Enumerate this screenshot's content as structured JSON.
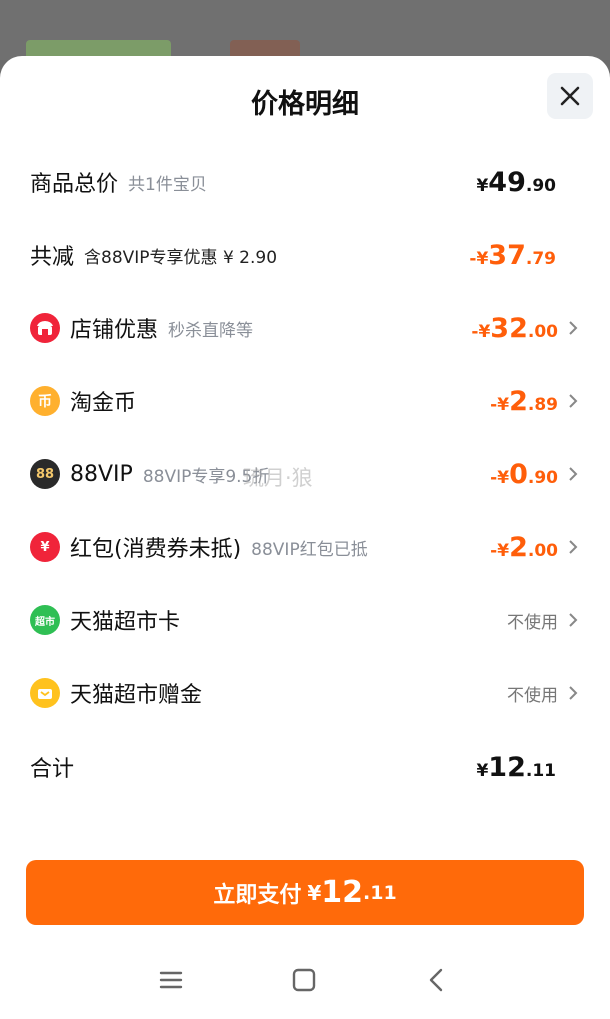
{
  "title": "价格明细",
  "rows": [
    {
      "label": "商品总价",
      "sub": "共1件宝贝",
      "sign": "",
      "currency": "¥",
      "int": "49",
      "dec": ".90"
    },
    {
      "label": "共减",
      "sub": "含88VIP专享优惠 ¥ 2.90",
      "sign": "-",
      "currency": "¥",
      "int": "37",
      "dec": ".79"
    },
    {
      "label": "店铺优惠",
      "sub": "秒杀直降等",
      "sign": "-",
      "currency": "¥",
      "int": "32",
      "dec": ".00",
      "icon": "shop-icon",
      "color": "#f0243a"
    },
    {
      "label": "淘金币",
      "sub": "",
      "sign": "-",
      "currency": "¥",
      "int": "2",
      "dec": ".89",
      "icon": "taojinbi-coin-icon",
      "icon_text": "币",
      "color": "#ffb02e"
    },
    {
      "label": "88VIP",
      "sub": "88VIP专享9.5折",
      "sign": "-",
      "currency": "¥",
      "int": "0",
      "dec": ".90",
      "icon": "88vip-icon",
      "icon_text": "88",
      "color": "#2a2a2a"
    },
    {
      "label": "红包(消费券未抵)",
      "sub": "88VIP红包已抵",
      "sign": "-",
      "currency": "¥",
      "int": "2",
      "dec": ".00",
      "icon": "red-packet-icon",
      "icon_text": "¥",
      "color": "#f0243a"
    },
    {
      "label": "天猫超市卡",
      "status": "不使用",
      "icon": "tmall-supermarket-card-icon",
      "icon_text": "超市",
      "color": "#2fbf54"
    },
    {
      "label": "天猫超市赠金",
      "status": "不使用",
      "icon": "tmall-gift-money-icon",
      "color": "#ffc21e"
    },
    {
      "label": "合计",
      "sub": "",
      "sign": "",
      "currency": "¥",
      "int": "12",
      "dec": ".11"
    }
  ],
  "pay_button": {
    "label": "立即支付",
    "currency": "¥",
    "int": "12",
    "dec": ".11",
    "color": "#ff6a0a"
  },
  "watermark": "琉月·狼",
  "nav": {
    "menu": "menu-icon",
    "home": "home-icon",
    "back": "back-icon"
  }
}
